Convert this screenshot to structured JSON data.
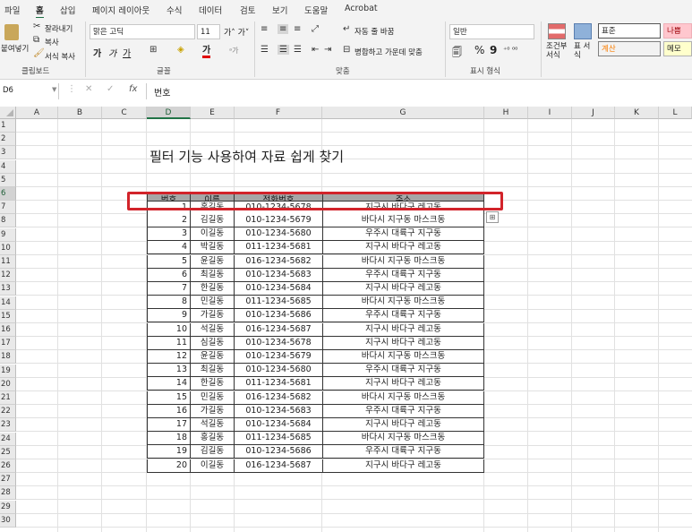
{
  "tabs": [
    "파일",
    "홈",
    "삽입",
    "페이지 레이아웃",
    "수식",
    "데이터",
    "검토",
    "보기",
    "도움말",
    "Acrobat"
  ],
  "ribbon": {
    "paste": "붙여넣기",
    "cut": "잘라내기",
    "copy": "복사",
    "format_painter": "서식 복사",
    "clipboard_label": "클립보드",
    "font_name": "맑은 고딕",
    "font_size": "11",
    "font_label": "글꼴",
    "wrap_text": "자동 줄 바꿈",
    "merge_center": "병합하고 가운데 맞춤",
    "align_label": "맞춤",
    "number_format": "일반",
    "number_label": "표시 형식",
    "cond_format": "조건부 서식",
    "table_format": "표 서식",
    "style_normal": "표준",
    "style_bad": "나쁨",
    "style_calc": "계산",
    "style_memo": "메모",
    "colors": {
      "bad_bg": "#ffc7ce",
      "bad_fg": "#9c0006",
      "calc_bg": "#f2f2f2",
      "calc_fg": "#fa7d00",
      "memo_bg": "#ffffcc",
      "accent": "#217346"
    }
  },
  "formula_bar": {
    "name_box": "D6",
    "content": "번호"
  },
  "columns": [
    "A",
    "B",
    "C",
    "D",
    "E",
    "F",
    "G",
    "H",
    "I",
    "J",
    "K",
    "L"
  ],
  "rows": [
    "1",
    "2",
    "3",
    "4",
    "5",
    "6",
    "7",
    "8",
    "9",
    "10",
    "11",
    "12",
    "13",
    "14",
    "15",
    "16",
    "17",
    "18",
    "19",
    "20",
    "21",
    "22",
    "23",
    "24",
    "25",
    "26",
    "27",
    "28",
    "29",
    "30"
  ],
  "sheet": {
    "title": "필터 기능 사용하여 자료 쉽게 찾기",
    "headers": [
      "번호",
      "이름",
      "전화번호",
      "주소"
    ],
    "records": [
      [
        "1",
        "홍길동",
        "010-1234-5678",
        "지구시 바다구 레고동"
      ],
      [
        "2",
        "김길동",
        "010-1234-5679",
        "바다시 지구동 마스크동"
      ],
      [
        "3",
        "이길동",
        "010-1234-5680",
        "우주시 대륙구 지구동"
      ],
      [
        "4",
        "박길동",
        "011-1234-5681",
        "지구시 바다구 레고동"
      ],
      [
        "5",
        "윤길동",
        "016-1234-5682",
        "바다시 지구동 마스크동"
      ],
      [
        "6",
        "최길동",
        "010-1234-5683",
        "우주시 대륙구 지구동"
      ],
      [
        "7",
        "한길동",
        "010-1234-5684",
        "지구시 바다구 레고동"
      ],
      [
        "8",
        "민길동",
        "011-1234-5685",
        "바다시 지구동 마스크동"
      ],
      [
        "9",
        "가길동",
        "010-1234-5686",
        "우주시 대륙구 지구동"
      ],
      [
        "10",
        "석길동",
        "016-1234-5687",
        "지구시 바다구 레고동"
      ],
      [
        "11",
        "심길동",
        "010-1234-5678",
        "지구시 바다구 레고동"
      ],
      [
        "12",
        "윤길동",
        "010-1234-5679",
        "바다시 지구동 마스크동"
      ],
      [
        "13",
        "최길동",
        "010-1234-5680",
        "우주시 대륙구 지구동"
      ],
      [
        "14",
        "한길동",
        "011-1234-5681",
        "지구시 바다구 레고동"
      ],
      [
        "15",
        "민길동",
        "016-1234-5682",
        "바다시 지구동 마스크동"
      ],
      [
        "16",
        "가길동",
        "010-1234-5683",
        "우주시 대륙구 지구동"
      ],
      [
        "17",
        "석길동",
        "010-1234-5684",
        "지구시 바다구 레고동"
      ],
      [
        "18",
        "홍길동",
        "011-1234-5685",
        "바다시 지구동 마스크동"
      ],
      [
        "19",
        "김길동",
        "010-1234-5686",
        "우주시 대륙구 지구동"
      ],
      [
        "20",
        "이길동",
        "016-1234-5687",
        "지구시 바다구 레고동"
      ]
    ]
  }
}
